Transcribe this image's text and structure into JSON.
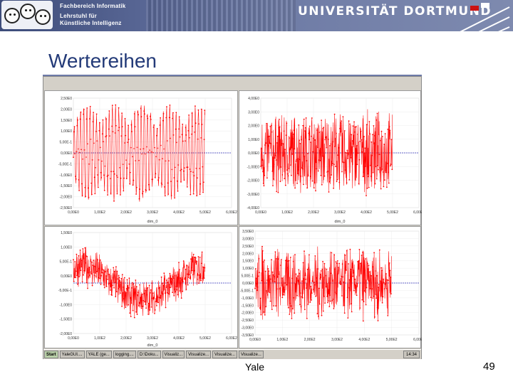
{
  "header": {
    "dept_line1": "Fachbereich Informatik",
    "dept_line2": "Lehrstuhl für",
    "dept_line3": "Künstliche Intelligenz",
    "university": "UNIVERSITÄT DORTMUND"
  },
  "slide": {
    "title": "Wertereihen",
    "footer": "Yale",
    "page_number": "49"
  },
  "colors": {
    "series": "#ff0000",
    "mean_line": "#3333bb",
    "title": "#233a78"
  },
  "taskbar": {
    "start": "Start",
    "buttons": [
      "YaleGUI....",
      "YALE (ge...",
      "logging....",
      "D:\\Doku...",
      "Visualiz...",
      "Visualize...",
      "Visualize...",
      "Visualize..."
    ],
    "clock": "14:34"
  },
  "chart_data": [
    {
      "type": "line",
      "title": "",
      "xlabel": "dim_0",
      "ylabel": "",
      "xlim": [
        0,
        600
      ],
      "ylim": [
        -2.5,
        2.5
      ],
      "x_ticks": [
        "0,00E0",
        "1,00E2",
        "2,00E2",
        "3,00E2",
        "4,00E2",
        "5,00E2",
        "6,00E2"
      ],
      "y_ticks": [
        "2,50E0",
        "2,00E0",
        "1,50E0",
        "1,00E0",
        "5,00E-1",
        "0,00E0",
        "-5,00E-1",
        "-1,00E0",
        "-1,50E0",
        "-2,00E0",
        "-2,50E0"
      ],
      "series": [
        {
          "pattern": "oscillating",
          "n_points": 500,
          "amplitude": 2.1,
          "mean": 0.0
        }
      ]
    },
    {
      "type": "line",
      "title": "",
      "xlabel": "dim_0",
      "ylabel": "",
      "xlim": [
        0,
        600
      ],
      "ylim": [
        -4.0,
        4.0
      ],
      "x_ticks": [
        "0,00E0",
        "1,00E2",
        "2,00E2",
        "3,00E2",
        "4,00E2",
        "5,00E2",
        "6,00E2"
      ],
      "y_ticks": [
        "4,00E0",
        "3,00E0",
        "2,00E0",
        "1,00E0",
        "0,00E0",
        "-1,00E0",
        "-2,00E0",
        "-3,00E0",
        "-4,00E0"
      ],
      "series": [
        {
          "pattern": "noise",
          "n_points": 500,
          "amplitude": 3.2,
          "mean": 0.0
        }
      ]
    },
    {
      "type": "line",
      "title": "",
      "xlabel": "dim_0",
      "ylabel": "",
      "xlim": [
        0,
        600
      ],
      "ylim": [
        -2.0,
        2.0
      ],
      "x_ticks": [
        "0,00E0",
        "1,00E2",
        "2,00E2",
        "3,00E2",
        "4,00E2",
        "5,00E2",
        "6,00E2"
      ],
      "y_ticks": [
        "1,50E0",
        "1,00E0",
        "5,00E-1",
        "0,00E0",
        "-5,00E-1",
        "-1,00E0",
        "-1,50E0",
        "-2,00E0"
      ],
      "series": [
        {
          "pattern": "wave",
          "n_points": 500,
          "amplitude": 1.1,
          "mean": 0.0
        }
      ]
    },
    {
      "type": "line",
      "title": "",
      "xlabel": "",
      "ylabel": "",
      "xlim": [
        0,
        600
      ],
      "ylim": [
        -4.0,
        4.0
      ],
      "x_ticks": [
        "0,00E0",
        "1,00E2",
        "2,00E2",
        "3,00E2",
        "4,00E2",
        "5,00E2",
        "6,00E2"
      ],
      "y_ticks": [
        "3,50E0",
        "3,00E0",
        "2,50E0",
        "2,00E0",
        "1,50E0",
        "1,00E0",
        "5,00E-1",
        "0,00E0",
        "-5,00E-1",
        "-1,00E0",
        "-1,50E0",
        "-2,00E0",
        "-2,50E0",
        "-3,00E0",
        "-3,50E0"
      ],
      "series": [
        {
          "pattern": "bursts",
          "n_points": 500,
          "amplitude": 3.0,
          "mean": 0.0
        }
      ]
    }
  ]
}
